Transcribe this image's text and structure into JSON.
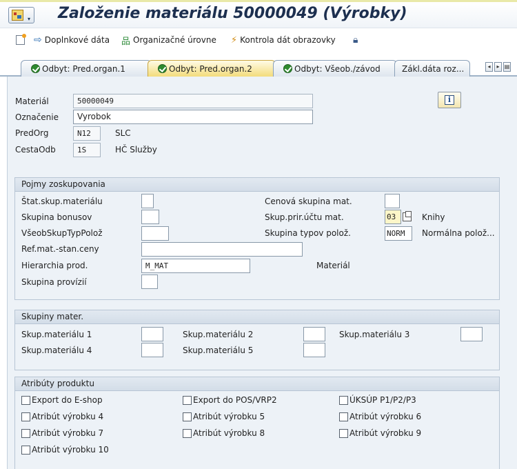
{
  "title": "Založenie materiálu 50000049 (Výrobky)",
  "toolbar": {
    "additional_data": "Doplnkové dáta",
    "org_levels": "Organizačné úrovne",
    "check_screen": "Kontrola dát obrazovky"
  },
  "tabs": [
    {
      "label": "Odbyt: Pred.organ.1"
    },
    {
      "label": "Odbyt: Pred.organ.2",
      "active": true
    },
    {
      "label": "Odbyt: Všeob./závod"
    },
    {
      "label": "Zákl.dáta roz..."
    }
  ],
  "header": {
    "material_label": "Materiál",
    "material_value": "50000049",
    "description_label": "Označenie",
    "description_value": "Vyrobok",
    "sales_org_label": "PredOrg",
    "sales_org_value": "N12",
    "sales_org_text": "SLC",
    "dist_channel_label": "CestaOdb",
    "dist_channel_value": "1S",
    "dist_channel_text": "HČ Služby"
  },
  "grouping": {
    "title": "Pojmy zoskupovania",
    "stat_group_label": "Štat.skup.materiálu",
    "stat_group_value": "",
    "price_group_label": "Cenová skupina mat.",
    "price_group_value": "",
    "rebate_group_label": "Skupina bonusov",
    "rebate_group_value": "",
    "acct_group_label": "Skup.prir.účtu mat.",
    "acct_group_value": "03",
    "acct_group_text": "Knihy",
    "gen_item_cat_label": "VšeobSkupTypPolož",
    "gen_item_cat_value": "",
    "item_cat_group_label": "Skupina typov polož.",
    "item_cat_group_value": "NORM",
    "item_cat_group_text": "Normálna polož...",
    "pricing_ref_label": "Ref.mat.-stan.ceny",
    "pricing_ref_value": "",
    "hierarchy_label": "Hierarchia prod.",
    "hierarchy_value": "M_MAT",
    "hierarchy_text": "Materiál",
    "commission_label": "Skupina provízií",
    "commission_value": ""
  },
  "mat_groups": {
    "title": "Skupiny mater.",
    "g1_label": "Skup.materiálu 1",
    "g2_label": "Skup.materiálu 2",
    "g3_label": "Skup.materiálu 3",
    "g4_label": "Skup.materiálu 4",
    "g5_label": "Skup.materiálu 5"
  },
  "attributes": {
    "title": "Atribúty produktu",
    "items": [
      {
        "label": "Export do E-shop",
        "checked": false
      },
      {
        "label": "Export do POS/VRP2",
        "checked": false
      },
      {
        "label": "ÚKSÚP P1/P2/P3",
        "checked": false
      },
      {
        "label": "Atribút výrobku 4",
        "checked": false
      },
      {
        "label": "Atribút výrobku 5",
        "checked": false
      },
      {
        "label": "Atribút výrobku 6",
        "checked": false
      },
      {
        "label": "Atribút výrobku 7",
        "checked": false
      },
      {
        "label": "Atribút výrobku 8",
        "checked": false
      },
      {
        "label": "Atribút výrobku 9",
        "checked": false
      },
      {
        "label": "Atribút výrobku 10",
        "checked": false
      }
    ]
  },
  "icons": {
    "menu": "sap-menu-icon",
    "new_doc": "new-document-icon",
    "additional_data": "arrow-right-icon",
    "org_levels": "org-tree-icon",
    "check_screen": "check-screen-icon",
    "lock": "lock-icon",
    "info": "info-icon",
    "tab_ok": "checkmark-ok-icon"
  },
  "colors": {
    "title_text": "#1c2f4f",
    "active_tab": "#f3dc7c",
    "panel_bg": "#edf2f7",
    "ok_green": "#2f8a2f"
  }
}
